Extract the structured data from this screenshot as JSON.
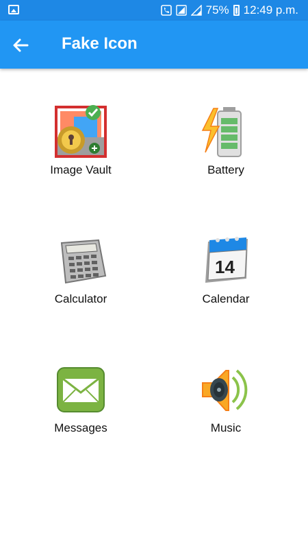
{
  "status": {
    "battery_text": "75%",
    "time": "12:49 p.m."
  },
  "app_bar": {
    "title": "Fake Icon"
  },
  "tiles": [
    {
      "label": "Image Vault",
      "icon": "image-vault-icon"
    },
    {
      "label": "Battery",
      "icon": "battery-icon"
    },
    {
      "label": "Calculator",
      "icon": "calculator-icon"
    },
    {
      "label": "Calendar",
      "icon": "calendar-icon"
    },
    {
      "label": "Messages",
      "icon": "messages-icon"
    },
    {
      "label": "Music",
      "icon": "music-icon"
    }
  ],
  "colors": {
    "status_bar": "#1e88e5",
    "app_bar": "#2196f3",
    "background": "#ffffff"
  }
}
